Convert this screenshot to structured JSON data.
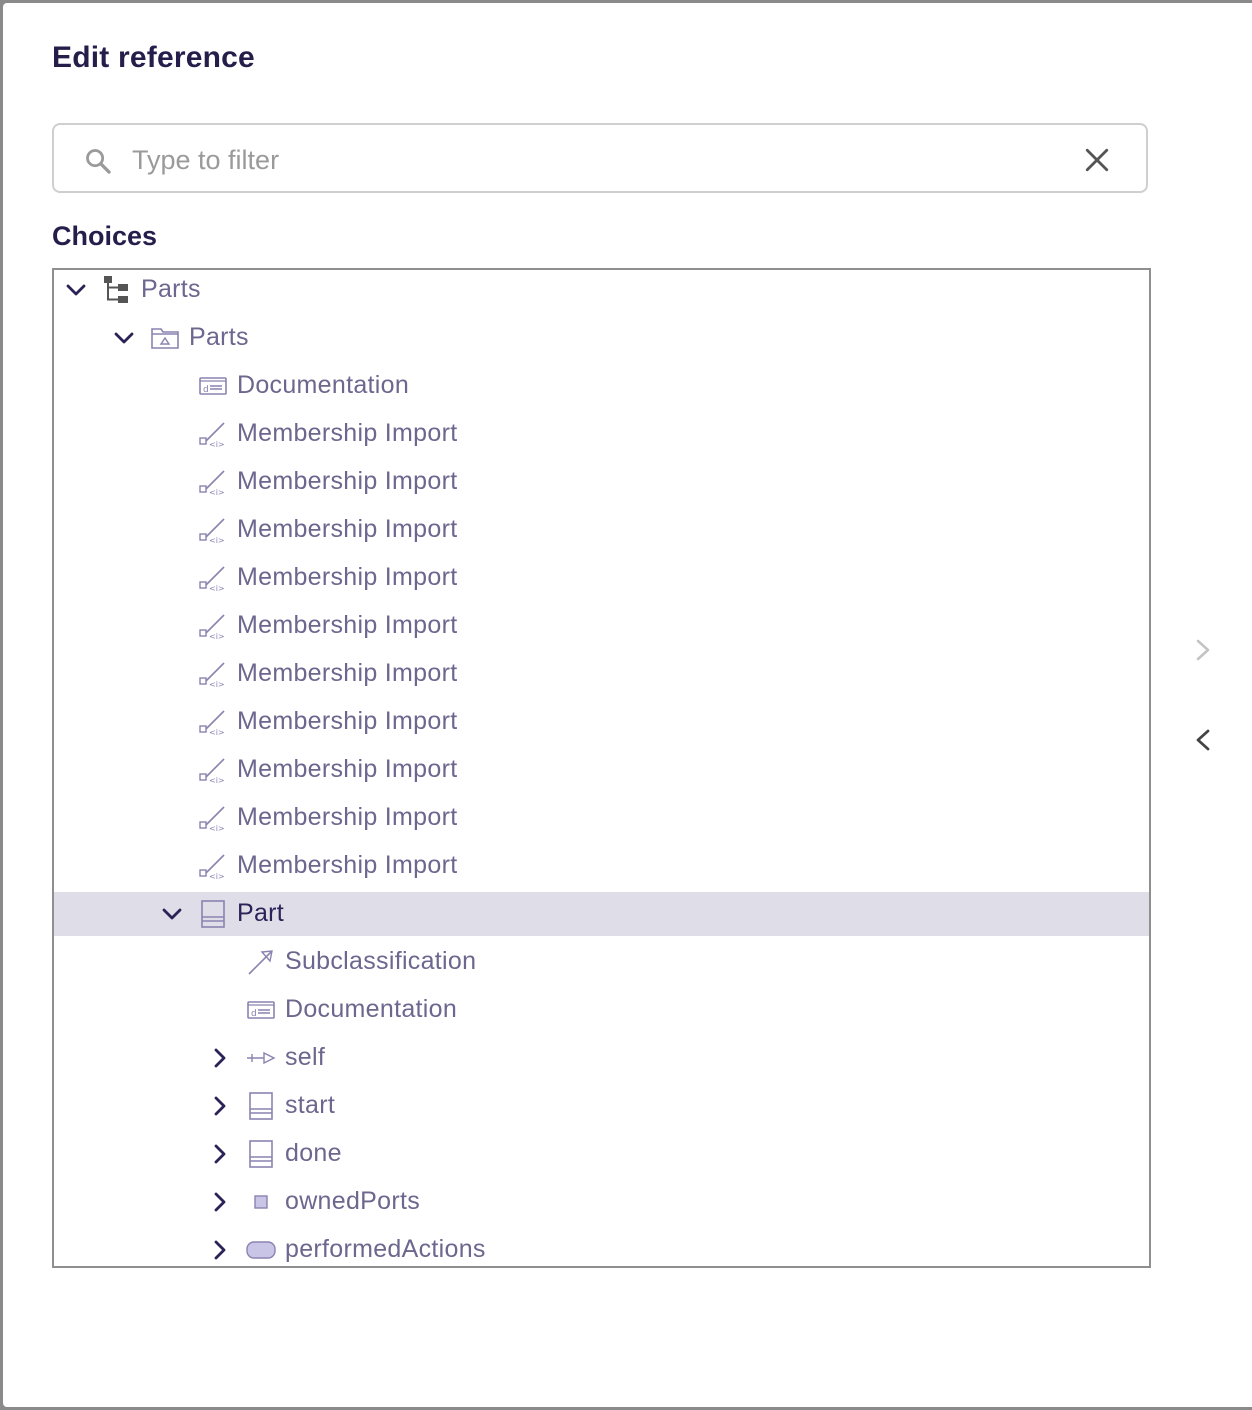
{
  "dialog": {
    "title": "Edit reference",
    "filter": {
      "placeholder": "Type to filter",
      "value": ""
    },
    "choices_label": "Choices"
  },
  "tree": [
    {
      "label": "Parts",
      "icon": "tree-root-icon",
      "level": 0,
      "expanded": true,
      "selected": false
    },
    {
      "label": "Parts",
      "icon": "package-folder-icon",
      "level": 1,
      "expanded": true,
      "selected": false
    },
    {
      "label": "Documentation",
      "icon": "documentation-icon",
      "level": 2,
      "expanded": null,
      "selected": false
    },
    {
      "label": "Membership Import",
      "icon": "membership-import-icon",
      "level": 2,
      "expanded": null,
      "selected": false
    },
    {
      "label": "Membership Import",
      "icon": "membership-import-icon",
      "level": 2,
      "expanded": null,
      "selected": false
    },
    {
      "label": "Membership Import",
      "icon": "membership-import-icon",
      "level": 2,
      "expanded": null,
      "selected": false
    },
    {
      "label": "Membership Import",
      "icon": "membership-import-icon",
      "level": 2,
      "expanded": null,
      "selected": false
    },
    {
      "label": "Membership Import",
      "icon": "membership-import-icon",
      "level": 2,
      "expanded": null,
      "selected": false
    },
    {
      "label": "Membership Import",
      "icon": "membership-import-icon",
      "level": 2,
      "expanded": null,
      "selected": false
    },
    {
      "label": "Membership Import",
      "icon": "membership-import-icon",
      "level": 2,
      "expanded": null,
      "selected": false
    },
    {
      "label": "Membership Import",
      "icon": "membership-import-icon",
      "level": 2,
      "expanded": null,
      "selected": false
    },
    {
      "label": "Membership Import",
      "icon": "membership-import-icon",
      "level": 2,
      "expanded": null,
      "selected": false
    },
    {
      "label": "Membership Import",
      "icon": "membership-import-icon",
      "level": 2,
      "expanded": null,
      "selected": false
    },
    {
      "label": "Part",
      "icon": "part-definition-icon",
      "level": 2,
      "expanded": true,
      "selected": true
    },
    {
      "label": "Subclassification",
      "icon": "subclassification-icon",
      "level": 3,
      "expanded": null,
      "selected": false
    },
    {
      "label": "Documentation",
      "icon": "documentation-icon",
      "level": 3,
      "expanded": null,
      "selected": false
    },
    {
      "label": "self",
      "icon": "reference-usage-icon",
      "level": 3,
      "expanded": false,
      "selected": false
    },
    {
      "label": "start",
      "icon": "part-definition-icon",
      "level": 3,
      "expanded": false,
      "selected": false
    },
    {
      "label": "done",
      "icon": "part-definition-icon",
      "level": 3,
      "expanded": false,
      "selected": false
    },
    {
      "label": "ownedPorts",
      "icon": "port-icon",
      "level": 3,
      "expanded": false,
      "selected": false
    },
    {
      "label": "performedActions",
      "icon": "action-icon",
      "level": 3,
      "expanded": false,
      "selected": false
    }
  ],
  "side_nav": [
    {
      "icon": "chevron-right-icon",
      "enabled": false
    },
    {
      "icon": "chevron-left-icon",
      "enabled": true
    }
  ],
  "colors": {
    "title": "#261e4a",
    "label": "#6d668e",
    "selected_bg": "#dedde8",
    "icon_stroke": "#8a83b0",
    "icon_fill": "#c9c5e6"
  }
}
